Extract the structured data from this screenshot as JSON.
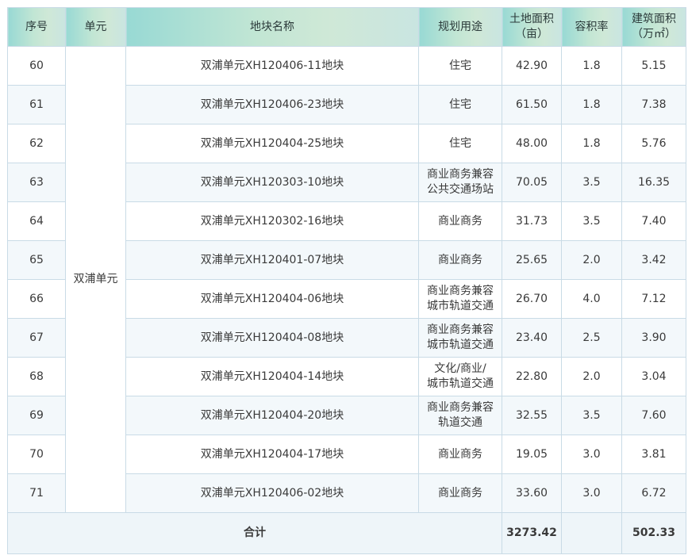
{
  "headers": {
    "seq": "序号",
    "unit": "单元",
    "plot_name": "地块名称",
    "usage": "规划用途",
    "land_area": "土地面积\n（亩）",
    "far": "容积率",
    "floor_area": "建筑面积\n（万㎡）"
  },
  "unit_name": "双浦单元",
  "rows": [
    {
      "seq": "60",
      "name": "双浦单元XH120406-11地块",
      "usage": "住宅",
      "area": "42.90",
      "far": "1.8",
      "floor": "5.15"
    },
    {
      "seq": "61",
      "name": "双浦单元XH120406-23地块",
      "usage": "住宅",
      "area": "61.50",
      "far": "1.8",
      "floor": "7.38"
    },
    {
      "seq": "62",
      "name": "双浦单元XH120404-25地块",
      "usage": "住宅",
      "area": "48.00",
      "far": "1.8",
      "floor": "5.76"
    },
    {
      "seq": "63",
      "name": "双浦单元XH120303-10地块",
      "usage": "商业商务兼容\n公共交通场站",
      "area": "70.05",
      "far": "3.5",
      "floor": "16.35"
    },
    {
      "seq": "64",
      "name": "双浦单元XH120302-16地块",
      "usage": "商业商务",
      "area": "31.73",
      "far": "3.5",
      "floor": "7.40"
    },
    {
      "seq": "65",
      "name": "双浦单元XH120401-07地块",
      "usage": "商业商务",
      "area": "25.65",
      "far": "2.0",
      "floor": "3.42"
    },
    {
      "seq": "66",
      "name": "双浦单元XH120404-06地块",
      "usage": "商业商务兼容\n城市轨道交通",
      "area": "26.70",
      "far": "4.0",
      "floor": "7.12"
    },
    {
      "seq": "67",
      "name": "双浦单元XH120404-08地块",
      "usage": "商业商务兼容\n城市轨道交通",
      "area": "23.40",
      "far": "2.5",
      "floor": "3.90"
    },
    {
      "seq": "68",
      "name": "双浦单元XH120404-14地块",
      "usage": "文化/商业/\n城市轨道交通",
      "area": "22.80",
      "far": "2.0",
      "floor": "3.04"
    },
    {
      "seq": "69",
      "name": "双浦单元XH120404-20地块",
      "usage": "商业商务兼容\n轨道交通",
      "area": "32.55",
      "far": "3.5",
      "floor": "7.60"
    },
    {
      "seq": "70",
      "name": "双浦单元XH120404-17地块",
      "usage": "商业商务",
      "area": "19.05",
      "far": "3.0",
      "floor": "3.81"
    },
    {
      "seq": "71",
      "name": "双浦单元XH120406-02地块",
      "usage": "商业商务",
      "area": "33.60",
      "far": "3.0",
      "floor": "6.72"
    }
  ],
  "total": {
    "label": "合计",
    "area": "3273.42",
    "far": "",
    "floor": "502.33"
  }
}
